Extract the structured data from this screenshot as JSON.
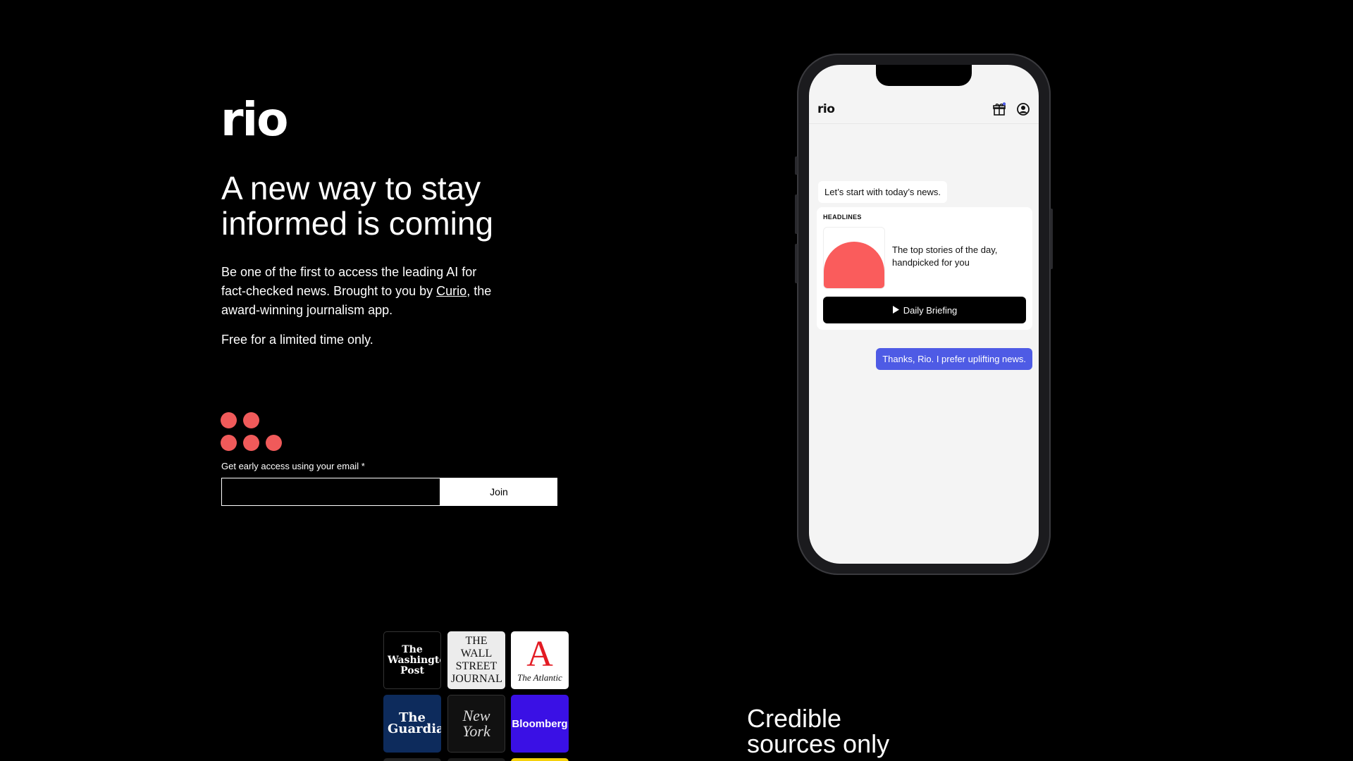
{
  "brand": {
    "logo_text": "rio",
    "accent_color": "#f05a5a"
  },
  "hero": {
    "headline": "A new way to stay informed is coming",
    "intro_before_link": "Be one of the first to access the leading AI for fact-checked news. Brought to you by ",
    "intro_link": "Curio",
    "intro_after_link": ", the award-winning journalism app.",
    "free_note": "Free for a limited time only."
  },
  "signup": {
    "label": "Get early access using your email *",
    "email_value": "",
    "join_label": "Join"
  },
  "phone": {
    "app_logo": "rio",
    "icons": [
      "gift-icon",
      "account-icon"
    ],
    "bot_message": "Let’s start with today’s news.",
    "card": {
      "label": "HEADLINES",
      "text": "The top stories of the day, handpicked for you",
      "button_label": "Daily Briefing"
    },
    "user_message": "Thanks, Rio. I prefer uplifting news.",
    "user_bubble_color": "#4e5be5"
  },
  "publishers": [
    {
      "name": "The Washington Post",
      "display": "The Washington Post"
    },
    {
      "name": "The Wall Street Journal",
      "display": "THE WALL STREET JOURNAL"
    },
    {
      "name": "The Atlantic",
      "display": "The Atlantic",
      "mark": "A"
    },
    {
      "name": "The Guardian",
      "display": "The Guardian"
    },
    {
      "name": "New York",
      "display": "New York"
    },
    {
      "name": "Bloomberg",
      "display": "Bloomberg"
    }
  ],
  "sources": {
    "heading": "Credible sources only"
  }
}
